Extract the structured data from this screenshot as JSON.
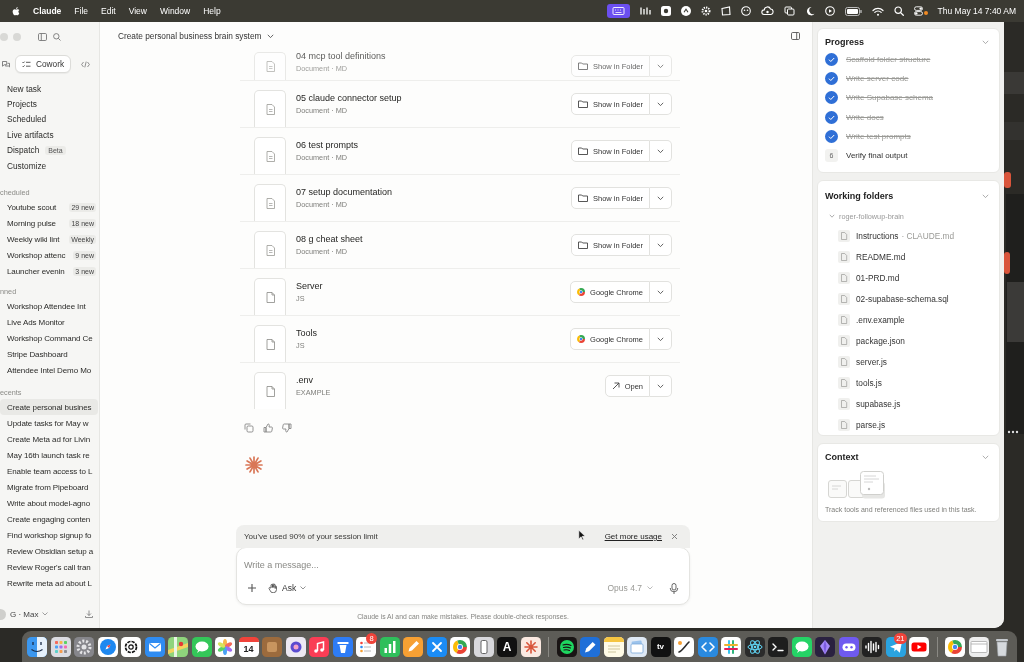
{
  "menu_bar": {
    "app_name": "Claude",
    "menus": [
      "File",
      "Edit",
      "View",
      "Window",
      "Help"
    ],
    "clock": "Thu May 14 7:40 AM"
  },
  "sidebar": {
    "tabs": [
      {
        "kind": "chat",
        "selected": false
      },
      {
        "kind": "cowork",
        "label": "Cowork",
        "selected": true
      },
      {
        "kind": "code",
        "selected": false
      }
    ],
    "nav_items": [
      {
        "label": "New task",
        "selected": false
      },
      {
        "label": "Projects",
        "selected": false
      },
      {
        "label": "Scheduled",
        "selected": false
      },
      {
        "label": "Live artifacts",
        "selected": false
      },
      {
        "label": "Dispatch",
        "badge": "Beta",
        "selected": false
      },
      {
        "label": "Customize",
        "selected": false
      }
    ],
    "sections": [
      {
        "title": "cheduled",
        "items": [
          {
            "label": "Youtube scout",
            "badge": "29 new",
            "selected": false
          },
          {
            "label": "Morning pulse",
            "badge": "18 new",
            "selected": false
          },
          {
            "label": "Weekly wiki lint",
            "badge": "Weekly",
            "selected": false
          },
          {
            "label": "Workshop attenc",
            "badge": "9 new",
            "selected": false
          },
          {
            "label": "Launcher evenin",
            "badge": "3 new",
            "selected": false
          }
        ]
      },
      {
        "title": "nned",
        "items": [
          {
            "label": "Workshop Attendee Int",
            "selected": false
          },
          {
            "label": "Live Ads Monitor",
            "selected": false
          },
          {
            "label": "Workshop Command Ce",
            "selected": false
          },
          {
            "label": "Stripe Dashboard",
            "selected": false
          },
          {
            "label": "Attendee Intel Demo Mo",
            "selected": false
          }
        ]
      },
      {
        "title": "ecents",
        "items": [
          {
            "label": "Create personal busines",
            "selected": true
          },
          {
            "label": "Update tasks for May w",
            "selected": false
          },
          {
            "label": "Create Meta ad for Livin",
            "selected": false
          },
          {
            "label": "May 16th launch task re",
            "selected": false
          },
          {
            "label": "Enable team access to L",
            "selected": false
          },
          {
            "label": "Migrate from Pipeboard",
            "selected": false
          },
          {
            "label": "Write about model-agno",
            "selected": false
          },
          {
            "label": "Create engaging conten",
            "selected": false
          },
          {
            "label": "Find workshop signup fo",
            "selected": false
          },
          {
            "label": "Review Obsidian setup a",
            "selected": false
          },
          {
            "label": "Review Roger's call tran",
            "selected": false
          },
          {
            "label": "Rewrite meta ad about L",
            "selected": false
          }
        ]
      }
    ],
    "account": {
      "label": "G · Max"
    }
  },
  "main": {
    "title": "Create personal business brain system",
    "files": [
      {
        "name": "04 mcp tool definitions",
        "meta": "Document · MD",
        "kind": "document",
        "action": {
          "kind": "folder",
          "label": "Show in Folder"
        }
      },
      {
        "name": "05 claude connector setup",
        "meta": "Document · MD",
        "kind": "document",
        "action": {
          "kind": "folder",
          "label": "Show in Folder"
        }
      },
      {
        "name": "06 test prompts",
        "meta": "Document · MD",
        "kind": "document",
        "action": {
          "kind": "folder",
          "label": "Show in Folder"
        }
      },
      {
        "name": "07 setup documentation",
        "meta": "Document · MD",
        "kind": "document",
        "action": {
          "kind": "folder",
          "label": "Show in Folder"
        }
      },
      {
        "name": "08 g cheat sheet",
        "meta": "Document · MD",
        "kind": "document",
        "action": {
          "kind": "folder",
          "label": "Show in Folder"
        }
      },
      {
        "name": "Server",
        "meta": "JS",
        "kind": "file",
        "action": {
          "kind": "browser",
          "label": "Google Chrome"
        }
      },
      {
        "name": "Tools",
        "meta": "JS",
        "kind": "file",
        "action": {
          "kind": "browser",
          "label": "Google Chrome"
        }
      },
      {
        "name": ".env",
        "meta": "EXAMPLE",
        "kind": "file",
        "action": {
          "kind": "open",
          "label": "Open"
        }
      }
    ],
    "usage_banner": {
      "text": "You've used 90% of your session limit",
      "link": "Get more usage"
    },
    "composer": {
      "placeholder": "Write a message...",
      "mode": "Ask",
      "model": "Opus 4.7"
    },
    "disclaimer": "Claude is AI and can make mistakes. Please double-check responses."
  },
  "right_panel": {
    "progress": {
      "title": "Progress",
      "items": [
        {
          "label": "Scaffold folder structure",
          "done": true
        },
        {
          "label": "Write server code",
          "done": true
        },
        {
          "label": "Write Supabase schema",
          "done": true
        },
        {
          "label": "Write docs",
          "done": true
        },
        {
          "label": "Write test prompts",
          "done": true
        },
        {
          "label": "Verify final output",
          "done": false,
          "number": "6"
        }
      ]
    },
    "working_folders": {
      "title": "Working folders",
      "tree": [
        {
          "label": "roger-followup-brain",
          "expanded": true,
          "children": [
            {
              "label": "Instructions",
              "note": "· CLAUDE.md"
            },
            {
              "label": "README.md"
            },
            {
              "label": "01-PRD.md"
            },
            {
              "label": "02-supabase-schema.sql"
            },
            {
              "label": ".env.example"
            },
            {
              "label": "package.json"
            },
            {
              "label": "server.js"
            },
            {
              "label": "tools.js"
            },
            {
              "label": "supabase.js"
            },
            {
              "label": "parse.js"
            }
          ]
        }
      ]
    },
    "context": {
      "title": "Context",
      "description": "Track tools and referenced files used in this task."
    }
  },
  "dock": {
    "date_tile": "14",
    "letter_tile": "A",
    "tv_tile": "tv",
    "badges": [
      "8",
      "21"
    ]
  }
}
